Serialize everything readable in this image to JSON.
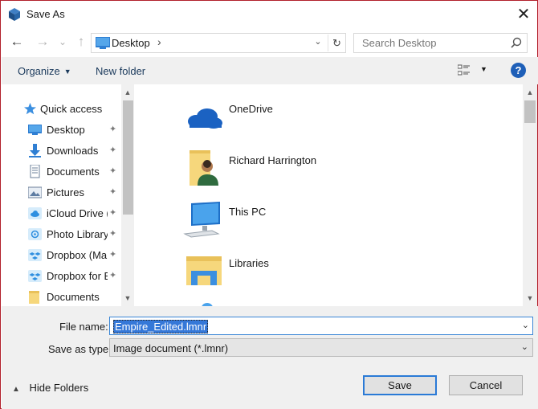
{
  "window": {
    "title": "Save As",
    "close_glyph": "✕"
  },
  "nav": {
    "back_glyph": "←",
    "forward_glyph": "→",
    "recent_glyph": "⌄",
    "up_glyph": "↑",
    "address": "Desktop",
    "address_sep": "›",
    "address_dropdown": "⌄",
    "refresh_glyph": "↻",
    "search_placeholder": "Search Desktop"
  },
  "toolbar": {
    "organize_label": "Organize",
    "organize_caret": "▼",
    "new_folder_label": "New folder",
    "view_caret": "▼",
    "help_label": "?"
  },
  "sidebar": {
    "items": [
      {
        "label": "Quick access",
        "icon": "star-icon"
      },
      {
        "label": "Desktop",
        "icon": "desktop-icon"
      },
      {
        "label": "Downloads",
        "icon": "download-icon"
      },
      {
        "label": "Documents",
        "icon": "documents-icon"
      },
      {
        "label": "Pictures",
        "icon": "pictures-icon"
      },
      {
        "label": "iCloud Drive (",
        "icon": "icloud-icon"
      },
      {
        "label": "Photo Library",
        "icon": "photos-icon"
      },
      {
        "label": "Dropbox (Ma",
        "icon": "dropbox-icon"
      },
      {
        "label": "Dropbox for E",
        "icon": "dropbox-icon"
      },
      {
        "label": "Documents",
        "icon": "folder-icon"
      }
    ],
    "pin_glyph": "📌",
    "scroll_up": "▲",
    "scroll_down": "▼"
  },
  "main": {
    "items": [
      {
        "label": "OneDrive",
        "icon": "onedrive-icon"
      },
      {
        "label": "Richard Harrington",
        "icon": "user-folder-icon"
      },
      {
        "label": "This PC",
        "icon": "computer-icon"
      },
      {
        "label": "Libraries",
        "icon": "libraries-icon"
      }
    ],
    "scroll_up": "▲",
    "scroll_down": "▼"
  },
  "form": {
    "filename_label": "File name:",
    "filename_value": "Empire_Edited.lmnr",
    "savetype_label": "Save as type:",
    "savetype_value": "Image document (*.lmnr)",
    "caret": "⌄"
  },
  "footer": {
    "hide_folders_caret": "▲",
    "hide_folders_label": "Hide Folders",
    "save_label": "Save",
    "cancel_label": "Cancel"
  },
  "colors": {
    "window_border": "#b1202b",
    "accent": "#1e5fb8",
    "selection": "#3578d8"
  }
}
